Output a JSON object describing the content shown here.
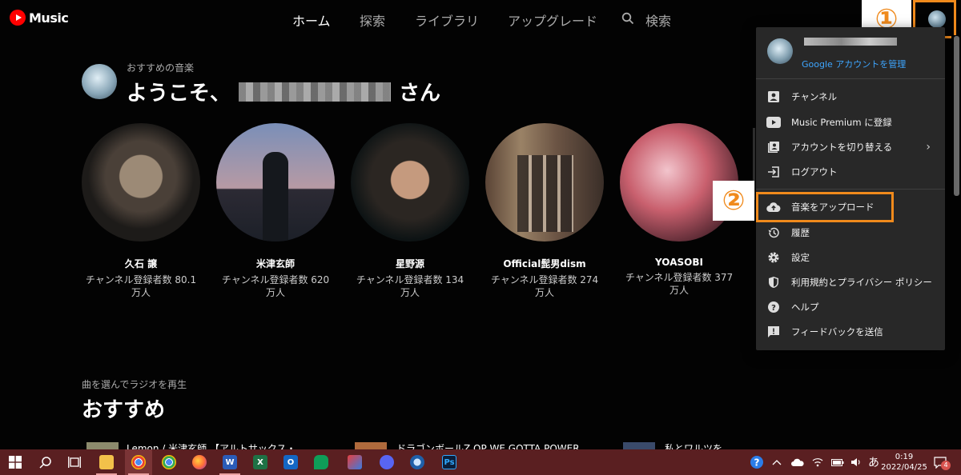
{
  "app": {
    "logo_text": "Music"
  },
  "nav": {
    "home": "ホーム",
    "explore": "探索",
    "library": "ライブラリ",
    "upgrade": "アップグレード",
    "search": "検索"
  },
  "callouts": {
    "one": "①",
    "two": "②"
  },
  "welcome": {
    "subtitle": "おすすめの音楽",
    "greeting": "ようこそ、",
    "suffix": "さん"
  },
  "artists": [
    {
      "name": "久石 譲",
      "subs": "チャンネル登録者数 80.1万人"
    },
    {
      "name": "米津玄師",
      "subs": "チャンネル登録者数 620万人"
    },
    {
      "name": "星野源",
      "subs": "チャンネル登録者数 134万人"
    },
    {
      "name": "Official髭男dism",
      "subs": "チャンネル登録者数 274万人"
    },
    {
      "name": "YOASOBI",
      "subs": "チャンネル登録者数 377万人"
    }
  ],
  "recommended": {
    "subtitle": "曲を選んでラジオを再生",
    "title": "おすすめ",
    "songs": [
      "Lemon / 米津玄師 【アルトサックス・",
      "ドラゴンボールZ OP WE GOTTA POWER",
      "私とワルツを"
    ]
  },
  "menu": {
    "manage_account": "Google アカウントを管理",
    "items": [
      {
        "label": "チャンネル",
        "icon": "channel-icon"
      },
      {
        "label": "Music Premium に登録",
        "icon": "youtube-icon"
      },
      {
        "label": "アカウントを切り替える",
        "icon": "switch-account-icon"
      },
      {
        "label": "ログアウト",
        "icon": "logout-icon"
      },
      {
        "label": "音楽をアップロード",
        "icon": "upload-cloud-icon"
      },
      {
        "label": "履歴",
        "icon": "history-icon"
      },
      {
        "label": "設定",
        "icon": "gear-icon"
      },
      {
        "label": "利用規約とプライバシー ポリシー",
        "icon": "shield-icon"
      },
      {
        "label": "ヘルプ",
        "icon": "help-icon"
      },
      {
        "label": "フィードバックを送信",
        "icon": "feedback-icon"
      }
    ]
  },
  "taskbar": {
    "ime": "あ",
    "time": "0:19",
    "date": "2022/04/25",
    "notifications": "4"
  },
  "colors": {
    "accent_orange": "#f08a1c",
    "link_blue": "#3ea6ff",
    "taskbar": "#5a1f21"
  }
}
